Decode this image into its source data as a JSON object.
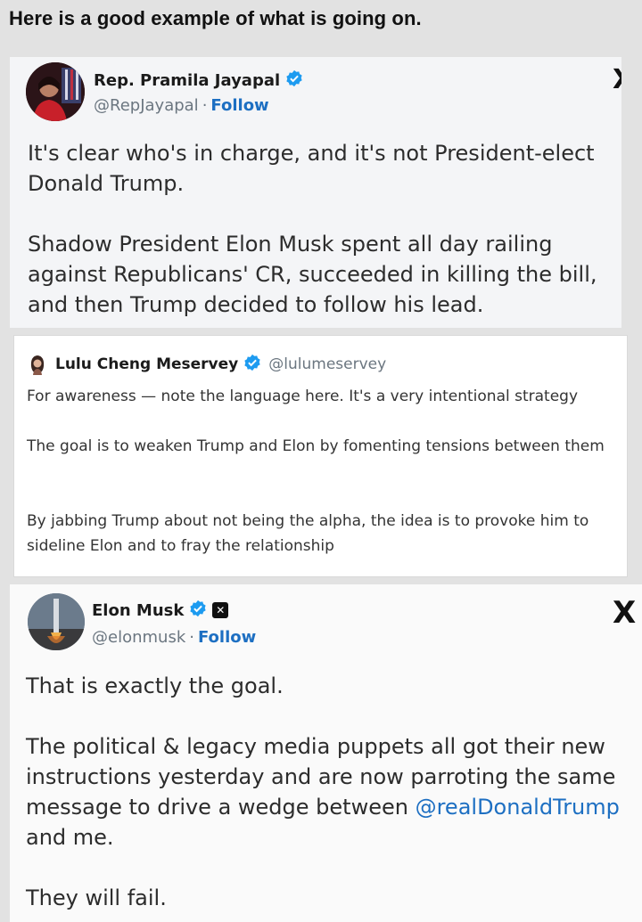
{
  "headline": "Here is a good example of what is going on.",
  "tweet1": {
    "name": "Rep. Pramila Jayapal",
    "handle": "@RepJayapal",
    "dot": "·",
    "follow": "Follow",
    "avatar_icon": "avatar-photo",
    "paragraphs": [
      "It's clear who's in charge, and it's not President-elect Donald Trump.",
      "Shadow President Elon Musk spent all day railing against Republicans' CR, succeeded in killing the bill, and then Trump decided to follow his lead."
    ]
  },
  "tweet2": {
    "name": "Lulu Cheng Meservey",
    "handle": "@lulumeservey",
    "paragraphs": [
      "For awareness — note the language here. It's a very intentional strategy",
      "The goal is to weaken Trump and Elon by fomenting tensions between them",
      "By jabbing Trump about not being the alpha, the idea is to provoke him to sideline Elon and to fray the relationship"
    ]
  },
  "tweet3": {
    "name": "Elon Musk",
    "handle": "@elonmusk",
    "dot": "·",
    "follow": "Follow",
    "line1": "That is exactly the goal.",
    "line2a": "The political & legacy media puppets all got their new instructions yesterday and are now parroting the same message to drive a wedge between ",
    "mention": "@realDonaldTrump",
    "line2b": " and me.",
    "line3": "They will fail."
  },
  "colors": {
    "verified": "#1d9bf0",
    "link": "#1d6fc2",
    "background": "#e2e2e2"
  }
}
